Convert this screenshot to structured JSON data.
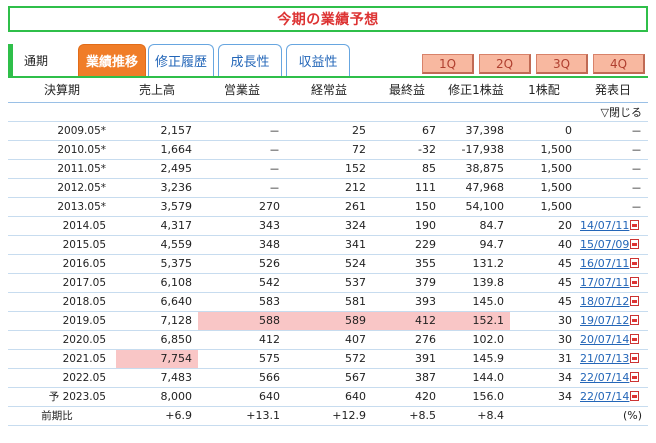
{
  "title": "今期の業績予想",
  "period_label": "通期",
  "tabs": [
    {
      "label": "業績推移",
      "active": true
    },
    {
      "label": "修正履歴",
      "active": false
    },
    {
      "label": "成長性",
      "active": false
    },
    {
      "label": "収益性",
      "active": false
    }
  ],
  "quarters": [
    "1Q",
    "2Q",
    "3Q",
    "4Q"
  ],
  "columns": [
    "決算期",
    "売上高",
    "営業益",
    "経常益",
    "最終益",
    "修正1株益",
    "1株配",
    "発表日"
  ],
  "toggle_label": "▽閉じる",
  "rows": [
    {
      "period": "2009.05*",
      "sales": "2,157",
      "op": "－",
      "ord": "25",
      "net": "67",
      "eps": "37,398",
      "div": "0",
      "date": "－",
      "has_pdf": false
    },
    {
      "period": "2010.05*",
      "sales": "1,664",
      "op": "－",
      "ord": "72",
      "net": "-32",
      "eps": "-17,938",
      "div": "1,500",
      "date": "－",
      "has_pdf": false
    },
    {
      "period": "2011.05*",
      "sales": "2,495",
      "op": "－",
      "ord": "152",
      "net": "85",
      "eps": "38,875",
      "div": "1,500",
      "date": "－",
      "has_pdf": false
    },
    {
      "period": "2012.05*",
      "sales": "3,236",
      "op": "－",
      "ord": "212",
      "net": "111",
      "eps": "47,968",
      "div": "1,500",
      "date": "－",
      "has_pdf": false
    },
    {
      "period": "2013.05*",
      "sales": "3,579",
      "op": "270",
      "ord": "261",
      "net": "150",
      "eps": "54,100",
      "div": "1,500",
      "date": "－",
      "has_pdf": false
    },
    {
      "period": "2014.05",
      "sales": "4,317",
      "op": "343",
      "ord": "324",
      "net": "190",
      "eps": "84.7",
      "div": "20",
      "date": "14/07/11",
      "has_pdf": true
    },
    {
      "period": "2015.05",
      "sales": "4,559",
      "op": "348",
      "ord": "341",
      "net": "229",
      "eps": "94.7",
      "div": "40",
      "date": "15/07/09",
      "has_pdf": true
    },
    {
      "period": "2016.05",
      "sales": "5,375",
      "op": "526",
      "ord": "524",
      "net": "355",
      "eps": "131.2",
      "div": "45",
      "date": "16/07/11",
      "has_pdf": true
    },
    {
      "period": "2017.05",
      "sales": "6,108",
      "op": "542",
      "ord": "537",
      "net": "379",
      "eps": "139.8",
      "div": "45",
      "date": "17/07/11",
      "has_pdf": true
    },
    {
      "period": "2018.05",
      "sales": "6,640",
      "op": "583",
      "ord": "581",
      "net": "393",
      "eps": "145.0",
      "div": "45",
      "date": "18/07/12",
      "has_pdf": true
    },
    {
      "period": "2019.05",
      "sales": "7,128",
      "op": "588",
      "ord": "589",
      "net": "412",
      "eps": "152.1",
      "div": "30",
      "date": "19/07/12",
      "has_pdf": true
    },
    {
      "period": "2020.05",
      "sales": "6,850",
      "op": "412",
      "ord": "407",
      "net": "276",
      "eps": "102.0",
      "div": "30",
      "date": "20/07/14",
      "has_pdf": true
    },
    {
      "period": "2021.05",
      "sales": "7,754",
      "op": "575",
      "ord": "572",
      "net": "391",
      "eps": "145.9",
      "div": "31",
      "date": "21/07/13",
      "has_pdf": true
    },
    {
      "period": "2022.05",
      "sales": "7,483",
      "op": "566",
      "ord": "567",
      "net": "387",
      "eps": "144.0",
      "div": "34",
      "date": "22/07/14",
      "has_pdf": true
    },
    {
      "period": "予 2023.05",
      "sales": "8,000",
      "op": "640",
      "ord": "640",
      "net": "420",
      "eps": "156.0",
      "div": "34",
      "date": "22/07/14",
      "has_pdf": true
    }
  ],
  "change_row": {
    "label": "前期比",
    "sales": "+6.9",
    "op": "+13.1",
    "ord": "+12.9",
    "net": "+8.5",
    "eps": "+8.4",
    "unit": "(%)"
  },
  "highlight_color": "#f9c6c6",
  "accent_color": "#2fbf4a",
  "tab_active_color": "#f07d28"
}
